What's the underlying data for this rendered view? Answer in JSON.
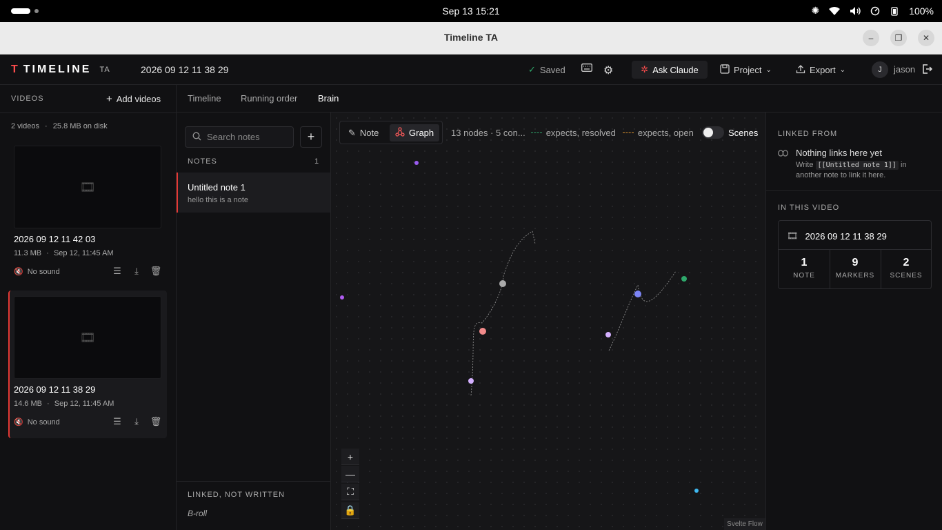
{
  "system": {
    "clock": "Sep 13  15:21",
    "battery": "100%"
  },
  "window": {
    "title": "Timeline TA"
  },
  "header": {
    "logo_word": "TIMELINE",
    "logo_ta": "TA",
    "project_name": "2026 09 12 11 38 29",
    "saved": "Saved",
    "ask_claude": "Ask Claude",
    "project": "Project",
    "export": "Export",
    "avatar_initial": "J",
    "user": "jason"
  },
  "videos": {
    "heading": "VIDEOS",
    "add": "Add videos",
    "count": "2 videos",
    "disk": "25.8 MB on disk",
    "items": [
      {
        "title": "2026 09 12 11 42 03",
        "size": "11.3 MB",
        "date": "Sep 12, 11:45 AM",
        "sound": "No sound"
      },
      {
        "title": "2026 09 12 11 38 29",
        "size": "14.6 MB",
        "date": "Sep 12, 11:45 AM",
        "sound": "No sound"
      }
    ]
  },
  "tabs": [
    "Timeline",
    "Running order",
    "Brain"
  ],
  "notes": {
    "search_placeholder": "Search notes",
    "heading": "NOTES",
    "count": "1",
    "items": [
      {
        "title": "Untitled note 1",
        "preview": "hello this is a note"
      }
    ],
    "linked_heading": "LINKED, NOT WRITTEN",
    "linked_items": [
      "B-roll"
    ]
  },
  "graph": {
    "note_btn": "Note",
    "graph_btn": "Graph",
    "info": "13 nodes · 5 con...",
    "legend_resolved": "expects, resolved",
    "legend_open": "expects, open",
    "scenes": "Scenes",
    "attribution": "Svelte Flow",
    "colors": {
      "resolved": "#2ea86b",
      "open": "#e0952e"
    }
  },
  "right": {
    "linked_from": "LINKED FROM",
    "nothing": "Nothing links here yet",
    "hint_write": "Write",
    "hint_code": "[[Untitled note 1]]",
    "hint_in": "in",
    "hint_rest": "another note to link it here.",
    "in_video": "IN THIS VIDEO",
    "video_title": "2026 09 12 11 38 29",
    "stats": [
      {
        "n": "1",
        "l": "NOTE"
      },
      {
        "n": "9",
        "l": "MARKERS"
      },
      {
        "n": "2",
        "l": "SCENES"
      }
    ]
  }
}
